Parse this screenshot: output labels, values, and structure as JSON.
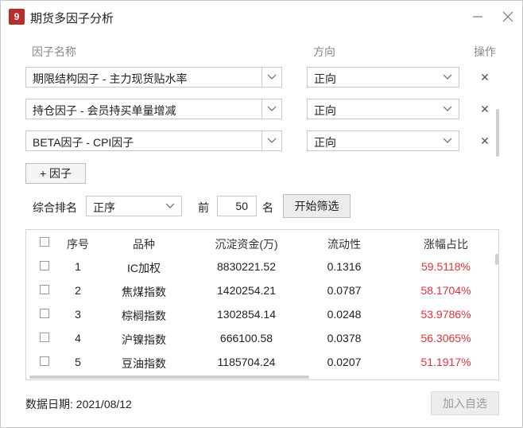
{
  "window": {
    "title": "期货多因子分析",
    "icon_text": "9"
  },
  "factor_header": {
    "name": "因子名称",
    "direction": "方向",
    "action": "操作"
  },
  "factors": [
    {
      "name": "期限结构因子 - 主力现货贴水率",
      "direction": "正向"
    },
    {
      "name": "持仓因子 - 会员持买单量增减",
      "direction": "正向"
    },
    {
      "name": "BETA因子 - CPI因子",
      "direction": "正向"
    }
  ],
  "add_factor_label": "+ 因子",
  "ranking": {
    "label": "综合排名",
    "order": "正序",
    "prefix": "前",
    "count": "50",
    "suffix": "名",
    "start_label": "开始筛选"
  },
  "table": {
    "columns": [
      "序号",
      "品种",
      "沉淀资金(万)",
      "流动性",
      "涨幅占比"
    ],
    "rows": [
      [
        "1",
        "IC加权",
        "8830221.52",
        "0.1316",
        "59.5118%"
      ],
      [
        "2",
        "焦煤指数",
        "1420254.21",
        "0.0787",
        "58.1704%"
      ],
      [
        "3",
        "棕榈指数",
        "1302854.14",
        "0.0248",
        "53.9786%"
      ],
      [
        "4",
        "沪镍指数",
        "666100.58",
        "0.0378",
        "56.3065%"
      ],
      [
        "5",
        "豆油指数",
        "1185704.24",
        "0.0207",
        "51.1917%"
      ]
    ]
  },
  "footer": {
    "date": "数据日期: 2021/08/12",
    "add_fav_label": "加入自选"
  },
  "colors": {
    "accent_red": "#e0343b",
    "icon_red": "#b5302c"
  }
}
